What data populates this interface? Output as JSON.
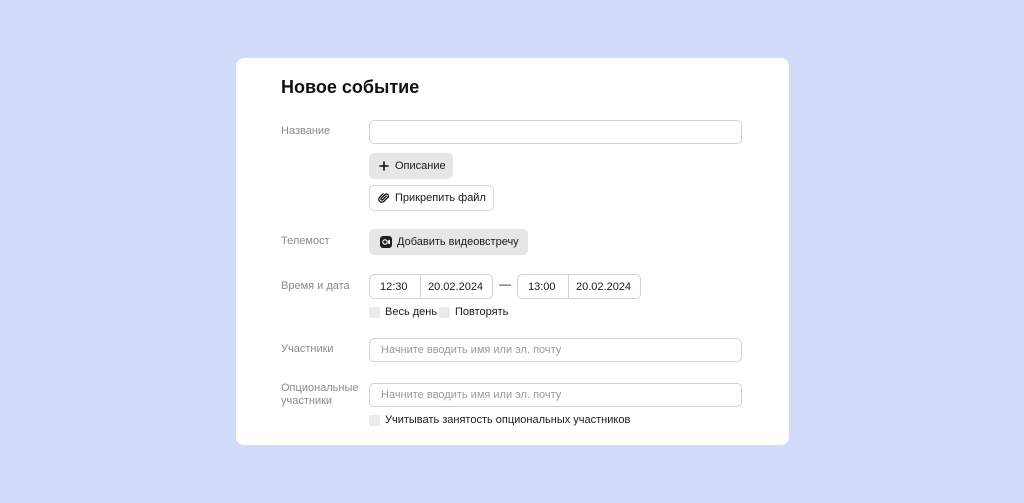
{
  "form": {
    "title": "Новое событие",
    "name_label": "Название",
    "name_value": "",
    "description_button": "Описание",
    "attach_button": "Прикрепить файл",
    "telemost_label": "Телемост",
    "videocall_button": "Добавить видеовстречу",
    "datetime_label": "Время и дата",
    "start_time": "12:30",
    "start_date": "20.02.2024",
    "range_separator": "—",
    "end_time": "13:00",
    "end_date": "20.02.2024",
    "all_day_label": "Весь день",
    "repeat_label": "Повторять",
    "participants_label": "Участники",
    "participants_placeholder": "Начните вводить имя или эл. почту",
    "optional_label_line1": "Опциональные",
    "optional_label_line2": "участники",
    "optional_placeholder": "Начните вводить имя или эл. почту",
    "optional_busy_label": "Учитывать занятость опциональных участников"
  },
  "icons": {
    "description_button": "plus-icon",
    "attach_button": "paperclip-icon",
    "videocall_button": "telemost-icon"
  },
  "colors": {
    "background": "#d3dbfb",
    "card": "#ffffff",
    "gray_button": "#e6e6e6"
  }
}
